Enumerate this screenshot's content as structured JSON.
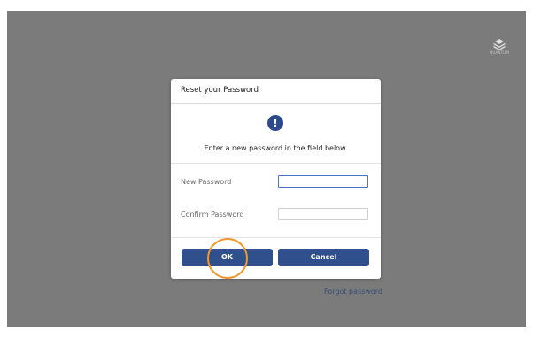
{
  "brand": {
    "logo_text": "QUANTUM",
    "logo_icon": "stacked-layers-icon"
  },
  "dialog": {
    "title": "Reset your Password",
    "icon": "info-exclamation-icon",
    "message": "Enter a new password in the field below.",
    "fields": [
      {
        "label": "New Password",
        "value": ""
      },
      {
        "label": "Confirm Password",
        "value": ""
      }
    ],
    "ok_label": "OK",
    "cancel_label": "Cancel"
  },
  "forgot_password_link": "Forgot password",
  "colors": {
    "backdrop": "#7b7b7b",
    "button": "#2f4f8d",
    "highlight": "#f0962a",
    "input_focus": "#4a72c8"
  }
}
